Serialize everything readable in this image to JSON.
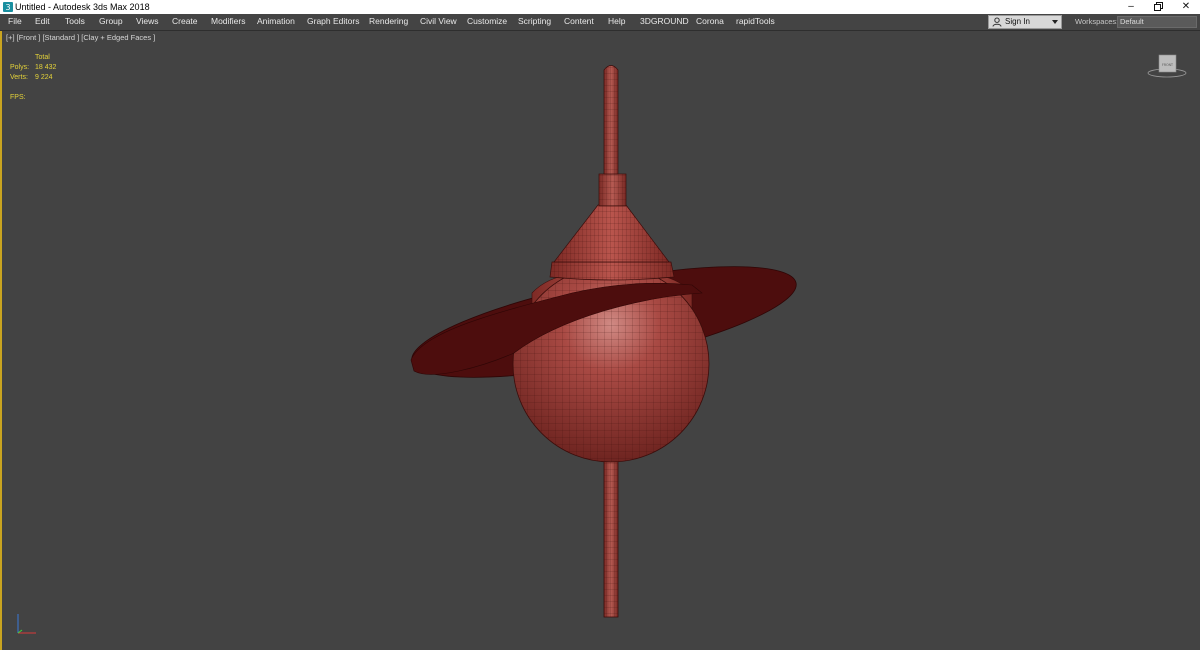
{
  "window": {
    "title": "Untitled - Autodesk 3ds Max 2018"
  },
  "menu": [
    "File",
    "Edit",
    "Tools",
    "Group",
    "Views",
    "Create",
    "Modifiers",
    "Animation",
    "Graph Editors",
    "Rendering",
    "Civil View",
    "Customize",
    "Scripting",
    "Content",
    "Help",
    "3DGROUND",
    "Corona",
    "rapidTools"
  ],
  "account": {
    "sign_in": "Sign In"
  },
  "workspaces": {
    "label": "Workspaces:",
    "value": "Default"
  },
  "viewport": {
    "label": "[+] [Front ] [Standard ] [Clay + Edged Faces ]",
    "stats": {
      "header": "Total",
      "polys_label": "Polys:",
      "polys_value": "18 432",
      "verts_label": "Verts:",
      "verts_value": "9 224",
      "fps_label": "FPS:"
    },
    "viewcube_face": "FRONT"
  },
  "colors": {
    "accent": "#c9a420",
    "model": "#9a3a35",
    "ring": "#4d0d0d",
    "background": "#434343",
    "stats_text": "#e5d33a"
  }
}
